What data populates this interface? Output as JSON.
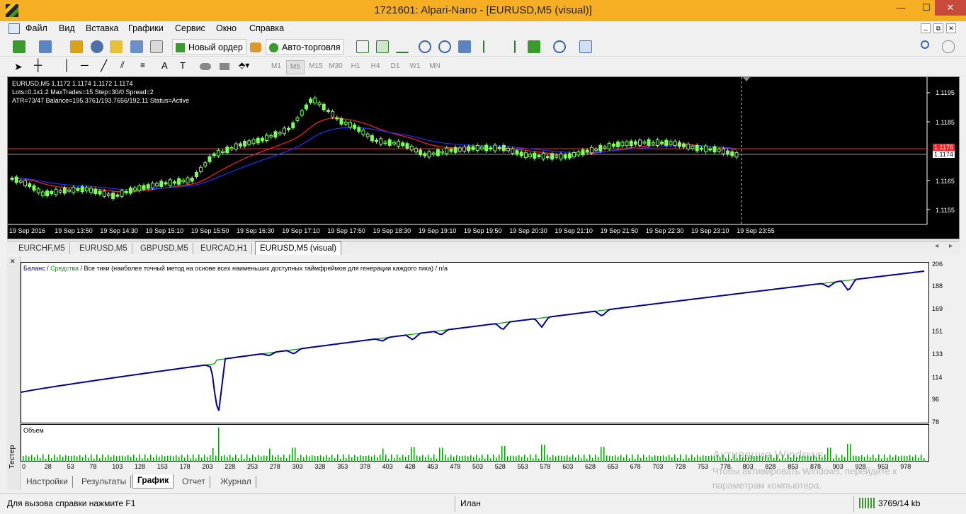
{
  "window": {
    "title": "1721601: Alpari-Nano - [EURUSD,M5 (visual)]",
    "min": "—",
    "max": "☐",
    "close": "✕",
    "doc_min": "_",
    "doc_restore": "⧉",
    "doc_close": "✕"
  },
  "menu": [
    "Файл",
    "Вид",
    "Вставка",
    "Графики",
    "Сервис",
    "Окно",
    "Справка"
  ],
  "toolbar": {
    "new_order": "Новый ордер",
    "auto_trading": "Авто-торговля"
  },
  "timeframes": [
    "M1",
    "M5",
    "M15",
    "M30",
    "H1",
    "H4",
    "D1",
    "W1",
    "MN"
  ],
  "chart": {
    "info": [
      "EURUSD,M5  1.1172 1.1174 1.1172 1.1174",
      "Lots=0.1x1.2 MaxTrades=15 Step=30/0 Spread=2",
      "ATR=73/47 Balance=195.3761/193.7656/192.11 Status=Active"
    ],
    "x_labels": [
      "19 Sep 2016",
      "19 Sep 13:50",
      "19 Sep 14:30",
      "19 Sep 15:10",
      "19 Sep 15:50",
      "19 Sep 16:30",
      "19 Sep 17:10",
      "19 Sep 17:50",
      "19 Sep 18:30",
      "19 Sep 19:10",
      "19 Sep 19:50",
      "19 Sep 20:30",
      "19 Sep 21:10",
      "19 Sep 21:50",
      "19 Sep 22:30",
      "19 Sep 23:10",
      "19 Sep 23:55"
    ],
    "y_labels": [
      "1.1195",
      "1.1185",
      "1.1165",
      "1.1155"
    ],
    "bid_label": "1.1176",
    "price_label": "1.1174"
  },
  "chart_tabs": [
    "EURCHF,M5",
    "EURUSD,M5",
    "GBPUSD,M5",
    "EURCAD,H1",
    "EURUSD,M5 (visual)"
  ],
  "equity": {
    "legend_balance": "Баланс",
    "legend_sep1": " / ",
    "legend_equity": "Средства",
    "legend_rest": " / Все тики (наиболее точный метод на основе всех наименьших доступных таймфреймов для генерации каждого тика) / n/a",
    "y_labels": [
      "206",
      "188",
      "169",
      "151",
      "133",
      "114",
      "96",
      "78"
    ],
    "volume_label": "Объем",
    "x_labels": [
      "0",
      "28",
      "53",
      "78",
      "103",
      "128",
      "153",
      "178",
      "203",
      "228",
      "253",
      "278",
      "303",
      "328",
      "353",
      "378",
      "403",
      "428",
      "453",
      "478",
      "503",
      "528",
      "553",
      "578",
      "603",
      "628",
      "653",
      "678",
      "703",
      "728",
      "753",
      "778",
      "803",
      "828",
      "853",
      "878",
      "903",
      "928",
      "953",
      "978"
    ]
  },
  "tester": {
    "side_label": "Тестер",
    "tabs": [
      "Настройки",
      "Результаты",
      "График",
      "Отчет",
      "Журнал"
    ]
  },
  "watermark": {
    "line1": "Активация Windows",
    "line2": "Чтобы активировать Windows, перейдите к",
    "line3": "параметрам компьютера."
  },
  "status": {
    "help": "Для вызова справки нажмите F1",
    "profile": "Илан",
    "traffic": "3769/14 kb"
  },
  "colors": {
    "bull": "#7dff5a",
    "ma_red": "#ff2020",
    "ma_blue": "#2030ff",
    "balance": "#000099",
    "equity": "#00a000"
  }
}
